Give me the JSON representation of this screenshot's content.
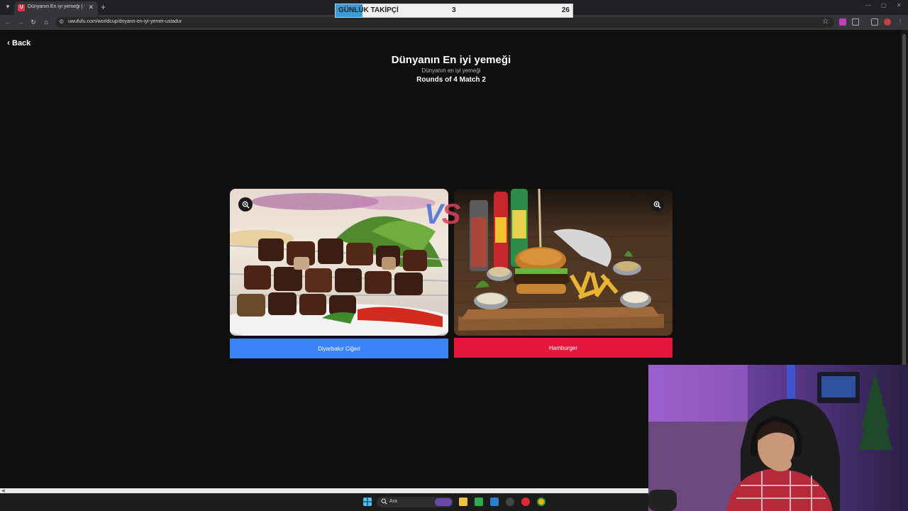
{
  "browser": {
    "tab_title": "Dünyanın En iyi yemeği | UwU",
    "tab_close": "✕",
    "new_tab": "+",
    "url": "uwufufu.com/worldcup/dnyann-en-iyi-yemei-ustadur"
  },
  "overlay": {
    "label": "GÜNLÜK TAKİPÇİ",
    "current": 3,
    "goal": 26,
    "fill_fraction": 0.115
  },
  "page": {
    "back_label": "Back",
    "title": "Dünyanın En iyi yemeği",
    "subtitle": "Dünyanın en iyi yemeği",
    "round_label": "Rounds of 4 Match 2",
    "vs_v": "V",
    "vs_s": "S",
    "left_choice": {
      "label": "Diyarbakır Ciğeri",
      "color": "#3b82f6"
    },
    "right_choice": {
      "label": "Hamburger",
      "color": "#e5173f"
    }
  },
  "taskbar": {
    "search_label": "Ara"
  },
  "colors": {
    "background": "#0f0f0f",
    "overlay_fill": "#3a9bd9"
  }
}
